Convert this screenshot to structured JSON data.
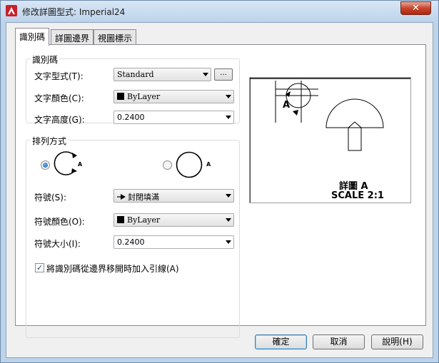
{
  "window": {
    "title": "修改詳圖型式: Imperial24",
    "close_glyph": "✕"
  },
  "tabs": [
    {
      "label": "識別碼",
      "active": true
    },
    {
      "label": "詳圖邊界",
      "active": false
    },
    {
      "label": "視圖標示",
      "active": false
    }
  ],
  "identifier_group": {
    "title": "識別碼",
    "text_style_label": "文字型式(T):",
    "text_style_value": "Standard",
    "browse_label": "...",
    "text_color_label": "文字顏色(C):",
    "text_color_value": "ByLayer",
    "text_height_label": "文字高度(G):",
    "text_height_value": "0.2400"
  },
  "arrangement_group": {
    "title": "排列方式",
    "option1_letter": "A",
    "option2_letter": "A",
    "selected_option": 1,
    "symbol_label": "符號(S):",
    "symbol_value": "封閉填滿",
    "symbol_color_label": "符號顏色(O):",
    "symbol_color_value": "ByLayer",
    "symbol_size_label": "符號大小(I):",
    "symbol_size_value": "0.2400",
    "leader_checkbox_label": "將識別碼從邊界移開時加入引線(A)",
    "leader_checked": true
  },
  "preview": {
    "callout_letter": "A",
    "detail_title": "詳圖 A",
    "detail_scale": "SCALE 2:1"
  },
  "buttons": {
    "ok": "確定",
    "cancel": "取消",
    "help": "說明(H)"
  },
  "colors": {
    "brand_icon": "#c8202b",
    "title_bg": "#c4d7ed",
    "default_button_border": "#3c7fb1"
  }
}
